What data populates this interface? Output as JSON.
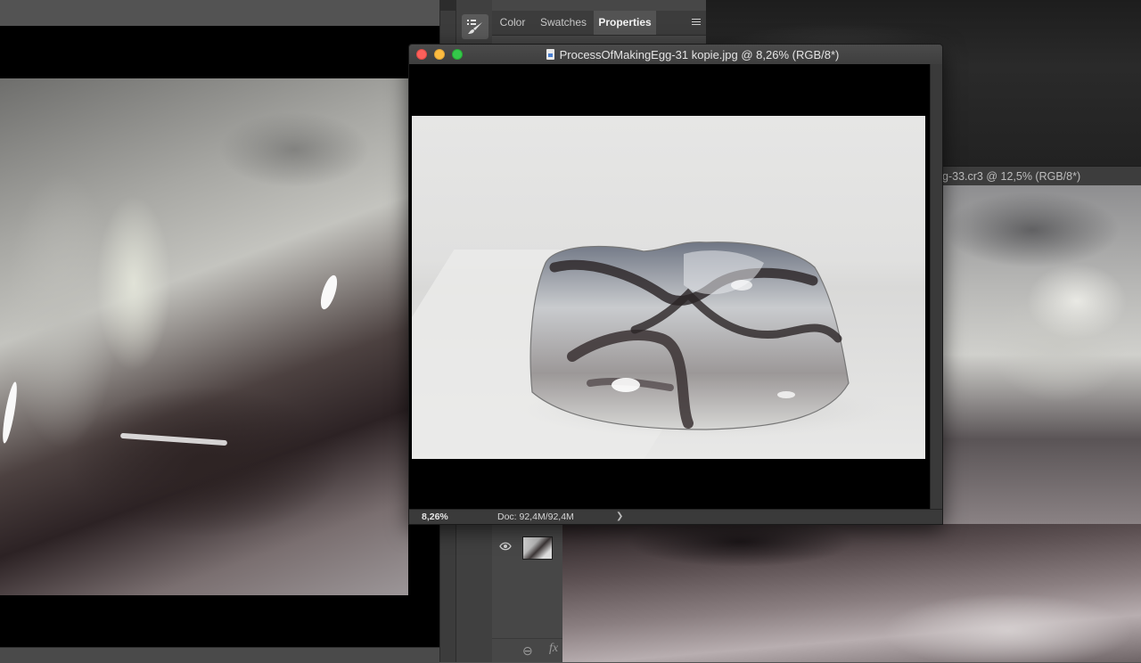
{
  "left_document": {
    "bottom_bar": ""
  },
  "panels": {
    "collapse_left": "‹‹",
    "collapse_right": "››",
    "tabs": [
      {
        "label": "Color",
        "active": false
      },
      {
        "label": "Swatches",
        "active": false
      },
      {
        "label": "Properties",
        "active": true
      }
    ],
    "menu_icon": "hamburger-icon",
    "tool_icon": "brush-presets-icon",
    "layers": {
      "visibility_icon": "eye-icon",
      "link_icon": "⊖",
      "fx_label": "fx"
    }
  },
  "focused_document": {
    "title": "ProcessOfMakingEgg-31 kopie.jpg @ 8,26% (RGB/8*)",
    "zoom": "8,26%",
    "doc_size": "Doc: 92,4M/92,4M",
    "status_menu": "❯",
    "traffic_colors": {
      "close": "#fc605b",
      "minimize": "#fdbc40",
      "zoom": "#34c84a"
    }
  },
  "background_document": {
    "title": "g-33.cr3 @ 12,5% (RGB/8*)"
  }
}
